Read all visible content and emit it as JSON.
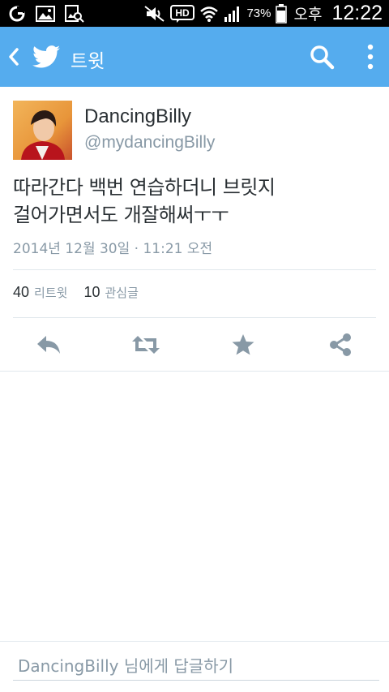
{
  "status_bar": {
    "battery_percent": "73%",
    "ampm": "오후",
    "time": "12:22",
    "network_label": "HD"
  },
  "app_bar": {
    "title": "트윗",
    "color": "#55acee"
  },
  "tweet": {
    "display_name": "DancingBilly",
    "handle": "@mydancingBilly",
    "text_line1": "따라간다 백번 연습하더니 브릿지",
    "text_line2": "걸어가면서도 개잘해써ㅜㅜ",
    "timestamp": "2014년 12월 30일 · 11:21 오전"
  },
  "stats": {
    "retweets_count": "40",
    "retweets_label": "리트윗",
    "favorites_count": "10",
    "favorites_label": "관심글"
  },
  "actions": {
    "icons": [
      "reply-icon",
      "retweet-icon",
      "favorite-icon",
      "share-icon"
    ]
  },
  "reply": {
    "placeholder": "DancingBilly 님에게 답글하기"
  }
}
